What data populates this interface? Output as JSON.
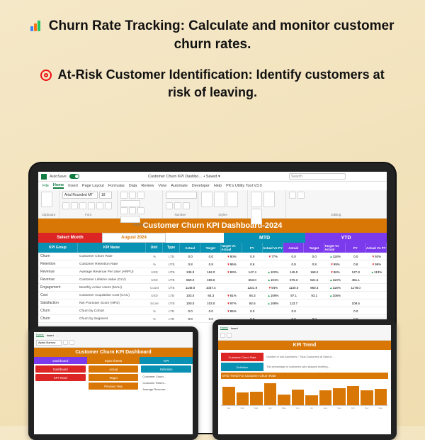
{
  "headlines": {
    "h1": "Churn Rate Tracking: Calculate and monitor customer churn rates.",
    "h2": "At-Risk Customer Identification: Identify customers at risk of leaving."
  },
  "excel": {
    "autosave_label": "AutoSave",
    "filename": "Customer Churn KPI Dashbo… • Saved ▾",
    "search_placeholder": "Search",
    "tabs": {
      "file": "File",
      "home": "Home",
      "insert": "Insert",
      "pagelayout": "Page Layout",
      "formulas": "Formulas",
      "data": "Data",
      "review": "Review",
      "view": "View",
      "automate": "Automate",
      "developer": "Developer",
      "help": "Help",
      "custom": "PK's Utility Tool V3.0"
    },
    "ribbon": {
      "font_name": "Arial Rounded MT",
      "font_size": "18",
      "groups": {
        "clipboard": "Clipboard",
        "font": "Font",
        "alignment": "Alignment",
        "number": "Number",
        "styles": "Styles",
        "cells": "Cells",
        "editing": "Editing"
      }
    }
  },
  "dashboard": {
    "title": "Customer Churn KPI Dashboard-2024",
    "select_month_label": "Select Month",
    "selected_month": "August 2024",
    "section_mtd": "MTD",
    "section_ytd": "YTD",
    "headers": {
      "group": "KPI Group",
      "name": "KPI Name",
      "unit": "Unit",
      "type": "Type",
      "actual": "Actual",
      "target": "Target",
      "tva": "Target Vs Actual",
      "py": "PY",
      "avp": "Actual Vs PY"
    },
    "rows": [
      {
        "group": "Churn",
        "name": "Customer Churn Rate",
        "unit": "%",
        "type": "LTB",
        "mtd": {
          "actual": "0.0",
          "target": "0.0",
          "tva": "80%",
          "tva_dir": "dn",
          "py": "0.0",
          "avp": "77%",
          "avp_dir": "dn"
        },
        "ytd": {
          "actual": "0.0",
          "target": "0.0",
          "tva": "118%",
          "tva_dir": "up",
          "py": "0.0",
          "avp": "93%",
          "avp_dir": "dn"
        }
      },
      {
        "group": "Retention",
        "name": "Customer Retention Rate",
        "unit": "%",
        "type": "UTB",
        "mtd": {
          "actual": "0.8",
          "target": "0.8",
          "tva": "96%",
          "tva_dir": "dn",
          "py": "0.8",
          "avp": "",
          "avp_dir": ""
        },
        "ytd": {
          "actual": "0.8",
          "target": "0.8",
          "tva": "99%",
          "tva_dir": "dn",
          "py": "0.8",
          "avp": "99%",
          "avp_dir": "dn"
        }
      },
      {
        "group": "Revenue",
        "name": "Average Revenue Per User (ARPU)",
        "unit": "USD",
        "type": "UTB",
        "mtd": {
          "actual": "135.0",
          "target": "162.0",
          "tva": "83%",
          "tva_dir": "dn",
          "py": "147.4",
          "avp": "102%",
          "avp_dir": "up"
        },
        "ytd": {
          "actual": "145.0",
          "target": "168.2",
          "tva": "86%",
          "tva_dir": "dn",
          "py": "127.8",
          "avp": "113%",
          "avp_dir": "up"
        }
      },
      {
        "group": "Revenue",
        "name": "Customer Lifetime Value (CLV)",
        "unit": "USD",
        "type": "UTB",
        "mtd": {
          "actual": "560.0",
          "target": "469.6",
          "tva": "",
          "tva_dir": "",
          "py": "553.0",
          "avp": "101%",
          "avp_dir": "up"
        },
        "ytd": {
          "actual": "576.3",
          "target": "521.5",
          "tva": "110%",
          "tva_dir": "up",
          "py": "481.1",
          "avp": "",
          "avp_dir": ""
        }
      },
      {
        "group": "Engagement",
        "name": "Monthly Active Users (MAU)",
        "unit": "Count",
        "type": "UTB",
        "mtd": {
          "actual": "1148.0",
          "target": "1037.4",
          "tva": "",
          "tva_dir": "",
          "py": "1221.9",
          "avp": "94%",
          "avp_dir": "dn"
        },
        "ytd": {
          "actual": "1130.0",
          "target": "960.3",
          "tva": "118%",
          "tva_dir": "up",
          "py": "1178.0",
          "avp": "",
          "avp_dir": ""
        }
      },
      {
        "group": "Cost",
        "name": "Customer Acquisition Cost (CAC)",
        "unit": "USD",
        "type": "LTB",
        "mtd": {
          "actual": "103.0",
          "target": "84.3",
          "tva": "81%",
          "tva_dir": "dn",
          "py": "94.3",
          "avp": "109%",
          "avp_dir": "up"
        },
        "ytd": {
          "actual": "87.1",
          "target": "93.1",
          "tva": "106%",
          "tva_dir": "up",
          "py": "",
          "avp": "",
          "avp_dir": ""
        }
      },
      {
        "group": "Satisfaction",
        "name": "Net Promoter Score (NPS)",
        "unit": "Score",
        "type": "UTB",
        "mtd": {
          "actual": "100.0",
          "target": "103.0",
          "tva": "97%",
          "tva_dir": "dn",
          "py": "92.6",
          "avp": "108%",
          "avp_dir": "up"
        },
        "ytd": {
          "actual": "113.7",
          "target": "",
          "tva": "",
          "tva_dir": "",
          "py": "109.5",
          "avp": "",
          "avp_dir": ""
        }
      },
      {
        "group": "Churn",
        "name": "Churn by Cohort",
        "unit": "%",
        "type": "LTB",
        "mtd": {
          "actual": "0.0",
          "target": "0.0",
          "tva": "85%",
          "tva_dir": "dn",
          "py": "0.0",
          "avp": "",
          "avp_dir": ""
        },
        "ytd": {
          "actual": "0.0",
          "target": "",
          "tva": "",
          "tva_dir": "",
          "py": "0.0",
          "avp": "",
          "avp_dir": ""
        }
      },
      {
        "group": "Churn",
        "name": "Churn by Segment",
        "unit": "%",
        "type": "LTB",
        "mtd": {
          "actual": "0.0",
          "target": "0.0",
          "tva": "",
          "tva_dir": "",
          "py": "0.0",
          "avp": "",
          "avp_dir": ""
        },
        "ytd": {
          "actual": "0.0",
          "target": "0.0",
          "tva": "",
          "tva_dir": "",
          "py": "0.0",
          "avp": "",
          "avp_dir": ""
        }
      }
    ]
  },
  "tablet1": {
    "font_name": "Aptos Narrow",
    "title": "Customer Churn KPI Dashboard",
    "col_heads": {
      "dash": "Dashboard",
      "input": "Input sheets",
      "kpi": "KPI"
    },
    "col1": [
      "Dashboard",
      "KPI Trend"
    ],
    "col2": [
      "Actual",
      "Target",
      "Previous Year"
    ],
    "col3": [
      "Definition"
    ],
    "kpi_list": [
      "Customer Churn…",
      "Customer Retent…",
      "Average Revenue…"
    ]
  },
  "tablet2": {
    "title": "KPI Trend",
    "kpi_label": "Customer Churn Rate",
    "desc": "Number of lost customers ÷ Total Customers at Start of…",
    "def_label": "Definition",
    "def_text": "The percentage of customers who stopped meeting…",
    "chart_title": "MTD Trend For Customer Churn Rate"
  },
  "chart_data": {
    "type": "bar",
    "title": "MTD Trend For Customer Churn Rate",
    "categories": [
      "Jan-24",
      "Feb-24",
      "Mar-24",
      "Apr-24",
      "May-24",
      "Jun-24",
      "Jul-24",
      "Aug-24",
      "Sep-24",
      "Oct-24",
      "Nov-24",
      "Dec-24"
    ],
    "values": [
      3.7,
      2.6,
      2.7,
      4.5,
      2.2,
      3.2,
      2.0,
      3.0,
      3.5,
      3.8,
      3.0,
      3.3
    ],
    "ylabel": "",
    "ylim": [
      0,
      5
    ]
  }
}
